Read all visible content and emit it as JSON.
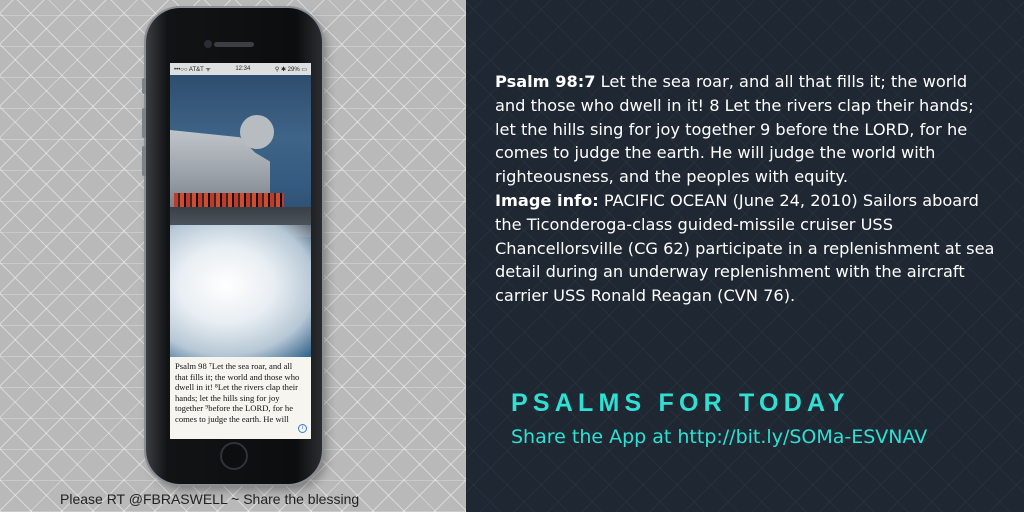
{
  "phone": {
    "status_carrier": "•••○○ AT&T ᯤ",
    "status_time": "12:34",
    "status_battery": "⚲ ✱ 29% ▭",
    "verse_lines": [
      "Psalm 98 ⁷Let the sea roar, and all",
      "that fills it; the world and those who",
      "dwell in it! ⁸Let the rivers clap their",
      "hands; let the hills sing for joy",
      "together ⁹before the LORD, for he",
      "comes to judge the earth. He will"
    ],
    "info_glyph": "i"
  },
  "caption": "Please RT @FBRASWELL ~ Share the blessing",
  "scripture": {
    "ref": "Psalm 98:7",
    "text": " Let the sea roar, and all that fills it; the world and those who dwell in it! 8 Let the rivers clap their hands; let the hills sing for joy together 9 before the LORD, for he comes to judge the earth. He will judge the world with righteousness, and the peoples with equity.",
    "info_label": "Image info:",
    "info_text": " PACIFIC OCEAN (June 24, 2010) Sailors aboard the Ticonderoga-class guided-missile cruiser USS Chancellorsville (CG 62) participate in a replenishment at sea detail during an underway replenishment with the aircraft carrier USS Ronald Reagan (CVN 76)."
  },
  "brand": {
    "title": "PSALMS FOR TODAY",
    "share": "Share the App at  http://bit.ly/SOMa-ESVNAV"
  },
  "colors": {
    "accent": "#2fe0d4",
    "dark_bg": "#1f2732",
    "light_bg": "#b9b9b9"
  }
}
